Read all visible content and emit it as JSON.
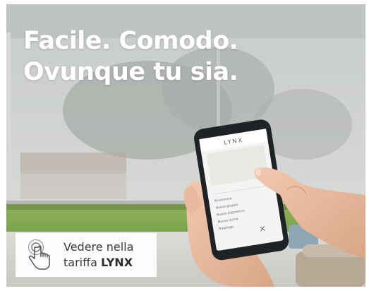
{
  "headline": {
    "line1": "Facile. Comodo.",
    "line2": "Ovunque tu sia."
  },
  "cta": {
    "line1": "Vedere nella",
    "line2_prefix": "tariffa ",
    "brand": "LYNX",
    "icon": "touch-hand-icon"
  },
  "phone": {
    "app_logo": "LYNX",
    "menu_items": [
      "Ricomincia",
      "Nuovo gruppo",
      "Nuovo dispositivo",
      "Nuova scena",
      "Riepilogo"
    ],
    "icon": "close-icon"
  },
  "colors": {
    "headline_text": "#ffffff",
    "cta_background": "#ffffff",
    "cta_text": "#3a3a3a"
  }
}
